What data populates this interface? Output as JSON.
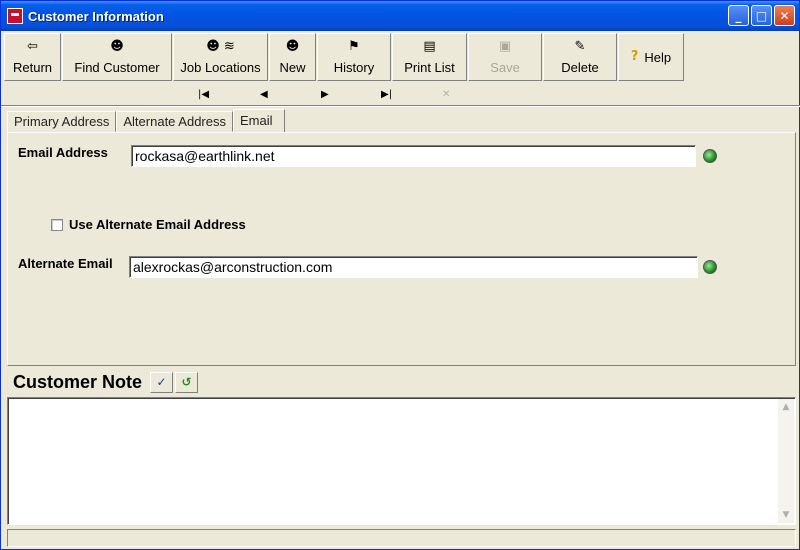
{
  "window": {
    "title": "Customer Information",
    "buttons": {
      "minimize": "_",
      "maximize": "□",
      "close": "✕"
    }
  },
  "toolbar": {
    "buttons": [
      {
        "label": "Return",
        "icon": "return-icon",
        "glyph": "⇦",
        "enabled": true
      },
      {
        "label": "Find Customer",
        "icon": "find-customer-icon",
        "glyph": "☻",
        "enabled": true
      },
      {
        "label": "Job Locations",
        "icon": "job-locations-icon",
        "glyph": "☻ ≋",
        "enabled": true
      },
      {
        "label": "New",
        "icon": "new-icon",
        "glyph": "☻",
        "enabled": true
      },
      {
        "label": "History",
        "icon": "history-icon",
        "glyph": "⚑",
        "enabled": true
      },
      {
        "label": "Print List",
        "icon": "printer-icon",
        "glyph": "▤",
        "enabled": true
      },
      {
        "label": "Save",
        "icon": "save-icon",
        "glyph": "▣",
        "enabled": false
      },
      {
        "label": "Delete",
        "icon": "delete-icon",
        "glyph": "✎",
        "enabled": true
      },
      {
        "label": "Help",
        "icon": "help-icon",
        "glyph": "?",
        "enabled": true
      }
    ]
  },
  "navigation": {
    "first": "|◀",
    "prev": "◀",
    "next": "▶",
    "last": "▶|",
    "cancel": "✕"
  },
  "tabs": [
    {
      "label": "Primary Address",
      "active": false
    },
    {
      "label": "Alternate Address",
      "active": false
    },
    {
      "label": "Email",
      "active": true
    }
  ],
  "email_tab": {
    "email_address_label": "Email Address",
    "email_address_value": "rockasa@earthlink.net",
    "use_alternate_label": "Use Alternate Email Address",
    "use_alternate_checked": false,
    "alternate_email_label": "Alternate Email",
    "alternate_email_value": "alexrockas@arconstruction.com"
  },
  "note": {
    "title": "Customer Note",
    "text": "",
    "spellcheck_icon": "spellcheck-icon",
    "undo_icon": "undo-icon"
  },
  "colors": {
    "titlebar": "#0055e5",
    "face": "#ece9d8",
    "status_dot": "#1f8f1f"
  }
}
